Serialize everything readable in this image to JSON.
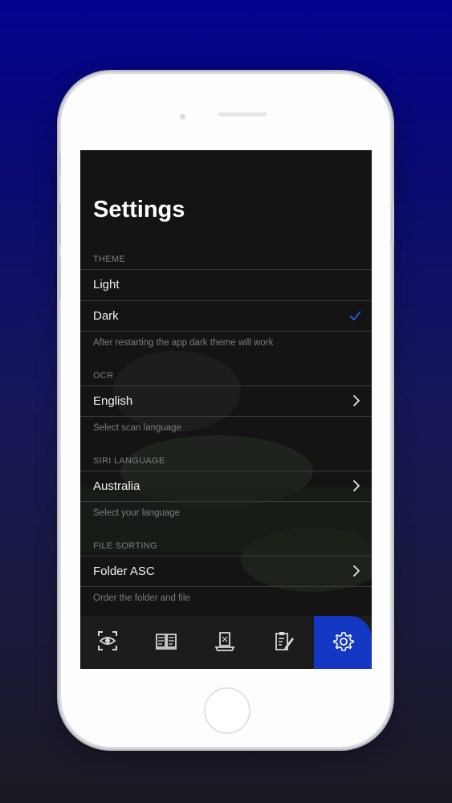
{
  "settings": {
    "title": "Settings",
    "theme": {
      "header": "THEME",
      "options": [
        "Light",
        "Dark"
      ],
      "selected": "Dark",
      "footer": "After restarting the app  dark theme will work"
    },
    "ocr": {
      "header": "OCR",
      "value": "English",
      "footer": "Select scan language"
    },
    "siri": {
      "header": "SIRI LANGUAGE",
      "value": "Australia",
      "footer": "Select your language"
    },
    "sorting": {
      "header": "FILE SORTING",
      "value": "Folder ASC",
      "footer": "Order the folder and file"
    }
  },
  "tabbar": {
    "tabs": [
      "scan-eye-icon",
      "book-icon",
      "document-scanner-icon",
      "notes-icon",
      "gear-icon"
    ],
    "active": "gear-icon",
    "active_color": "#1438c4"
  }
}
